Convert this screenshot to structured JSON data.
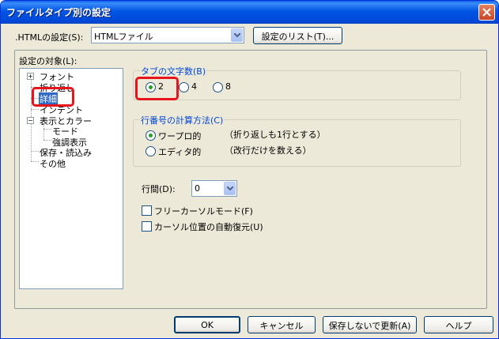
{
  "window": {
    "title": "ファイルタイプ別の設定"
  },
  "header": {
    "settings_label": ".HTMLの設定(S):",
    "filetype_value": "HTMLファイル",
    "list_button": "設定のリスト(T)..."
  },
  "tree": {
    "label": "設定の対象(L):",
    "items": [
      "フォント",
      "折り返し",
      "詳細",
      "インデント",
      "表示とカラー",
      "モード",
      "強調表示",
      "保存・読込み",
      "その他"
    ]
  },
  "tab_chars": {
    "title": "タブの文字数(B)",
    "options": [
      "2",
      "4",
      "8"
    ],
    "selected": "2"
  },
  "line_calc": {
    "title": "行番号の計算方法(C)",
    "options": [
      {
        "label": "ワープロ的",
        "desc": "（折り返しも1行とする）"
      },
      {
        "label": "エディタ的",
        "desc": "（改行だけを数える）"
      }
    ],
    "selected": "ワープロ的"
  },
  "spacing": {
    "label": "行間(D):",
    "value": "0"
  },
  "checkboxes": {
    "free_cursor": "フリーカーソルモード(F)",
    "auto_restore": "カーソル位置の自動復元(U)"
  },
  "buttons": {
    "ok": "OK",
    "cancel": "キャンセル",
    "update": "保存しないで更新(A)",
    "help": "ヘルプ"
  },
  "colors": {
    "title_bar": "#0055E5",
    "highlight": "#E8141B",
    "selection": "#316AC5"
  }
}
